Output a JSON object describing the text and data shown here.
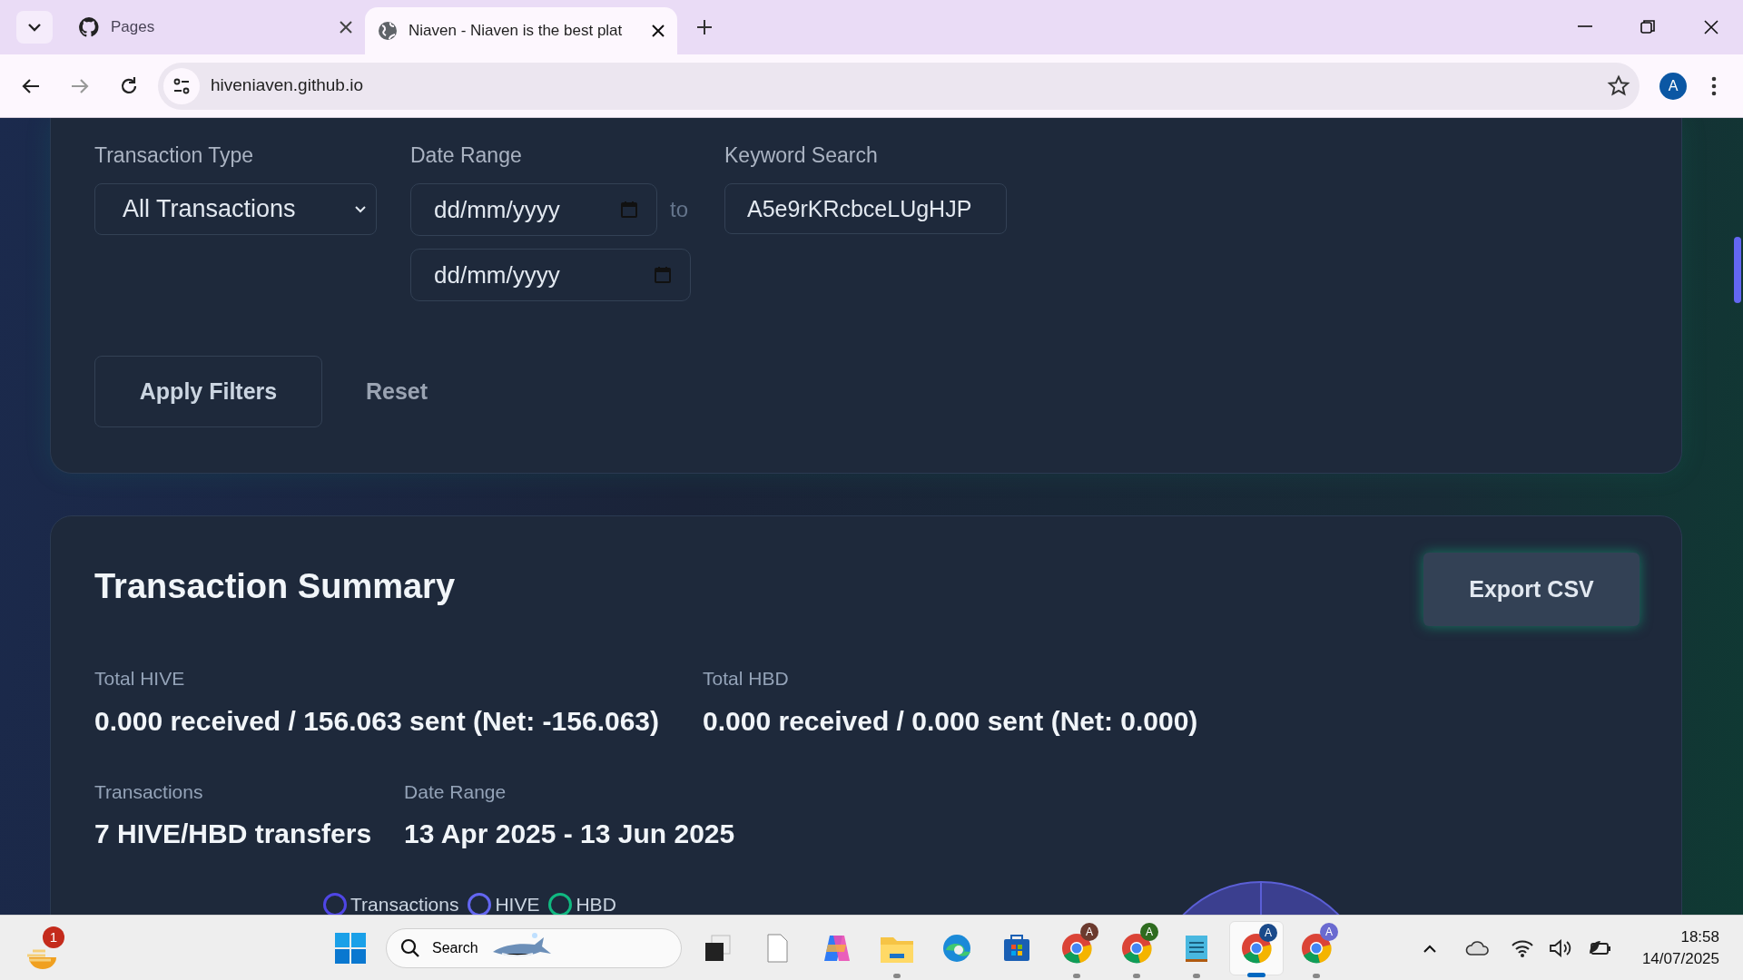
{
  "browser": {
    "tabs": [
      {
        "title": "Pages",
        "selected": false
      },
      {
        "title": "Niaven - Niaven is the best plat",
        "selected": true
      }
    ],
    "url": "hiveniaven.github.io",
    "profile_initial": "A"
  },
  "filters": {
    "type_label": "Transaction Type",
    "type_value": "All Transactions",
    "date_label": "Date Range",
    "date_from_placeholder": "dd/mm/yyyy",
    "date_separator": "to",
    "date_to_placeholder": "dd/mm/yyyy",
    "keyword_label": "Keyword Search",
    "keyword_value": "A5e9rKRcbceLUgHJP",
    "apply_button": "Apply Filters",
    "reset_button": "Reset"
  },
  "summary": {
    "title": "Transaction Summary",
    "export_button": "Export CSV",
    "stats": [
      {
        "label": "Total HIVE",
        "value": "0.000 received / 156.063 sent (Net: -156.063)"
      },
      {
        "label": "Total HBD",
        "value": "0.000 received / 0.000 sent (Net: 0.000)"
      },
      {
        "label": "Transactions",
        "value": "7 HIVE/HBD transfers"
      },
      {
        "label": "Date Range",
        "value": "13 Apr 2025 - 13 Jun 2025"
      }
    ],
    "legend": [
      {
        "label": "Transactions",
        "color": "#4f46e5"
      },
      {
        "label": "HIVE",
        "color": "#6366f1"
      },
      {
        "label": "HBD",
        "color": "#10b981"
      }
    ]
  },
  "taskbar": {
    "notification_count": "1",
    "search_placeholder": "Search",
    "apps": [
      {
        "kind": "taskview",
        "running": false,
        "selected": false
      },
      {
        "kind": "file",
        "running": false,
        "selected": false
      },
      {
        "kind": "copilot",
        "running": false,
        "selected": false
      },
      {
        "kind": "folder",
        "running": true,
        "selected": false
      },
      {
        "kind": "edge",
        "running": false,
        "selected": false
      },
      {
        "kind": "store",
        "running": false,
        "selected": false
      },
      {
        "kind": "chrome",
        "running": true,
        "selected": false,
        "badge": "A",
        "color": "#6b3a2e"
      },
      {
        "kind": "chrome",
        "running": true,
        "selected": false,
        "badge": "A",
        "color": "#2e6b1f"
      },
      {
        "kind": "notepad",
        "running": true,
        "selected": false
      },
      {
        "kind": "chrome",
        "running": true,
        "selected": true,
        "badge": "A",
        "color": "#1a4a8a"
      },
      {
        "kind": "chrome",
        "running": true,
        "selected": false,
        "badge": "A",
        "color": "#6a6ad0"
      }
    ],
    "time": "18:58",
    "date": "14/07/2025"
  }
}
